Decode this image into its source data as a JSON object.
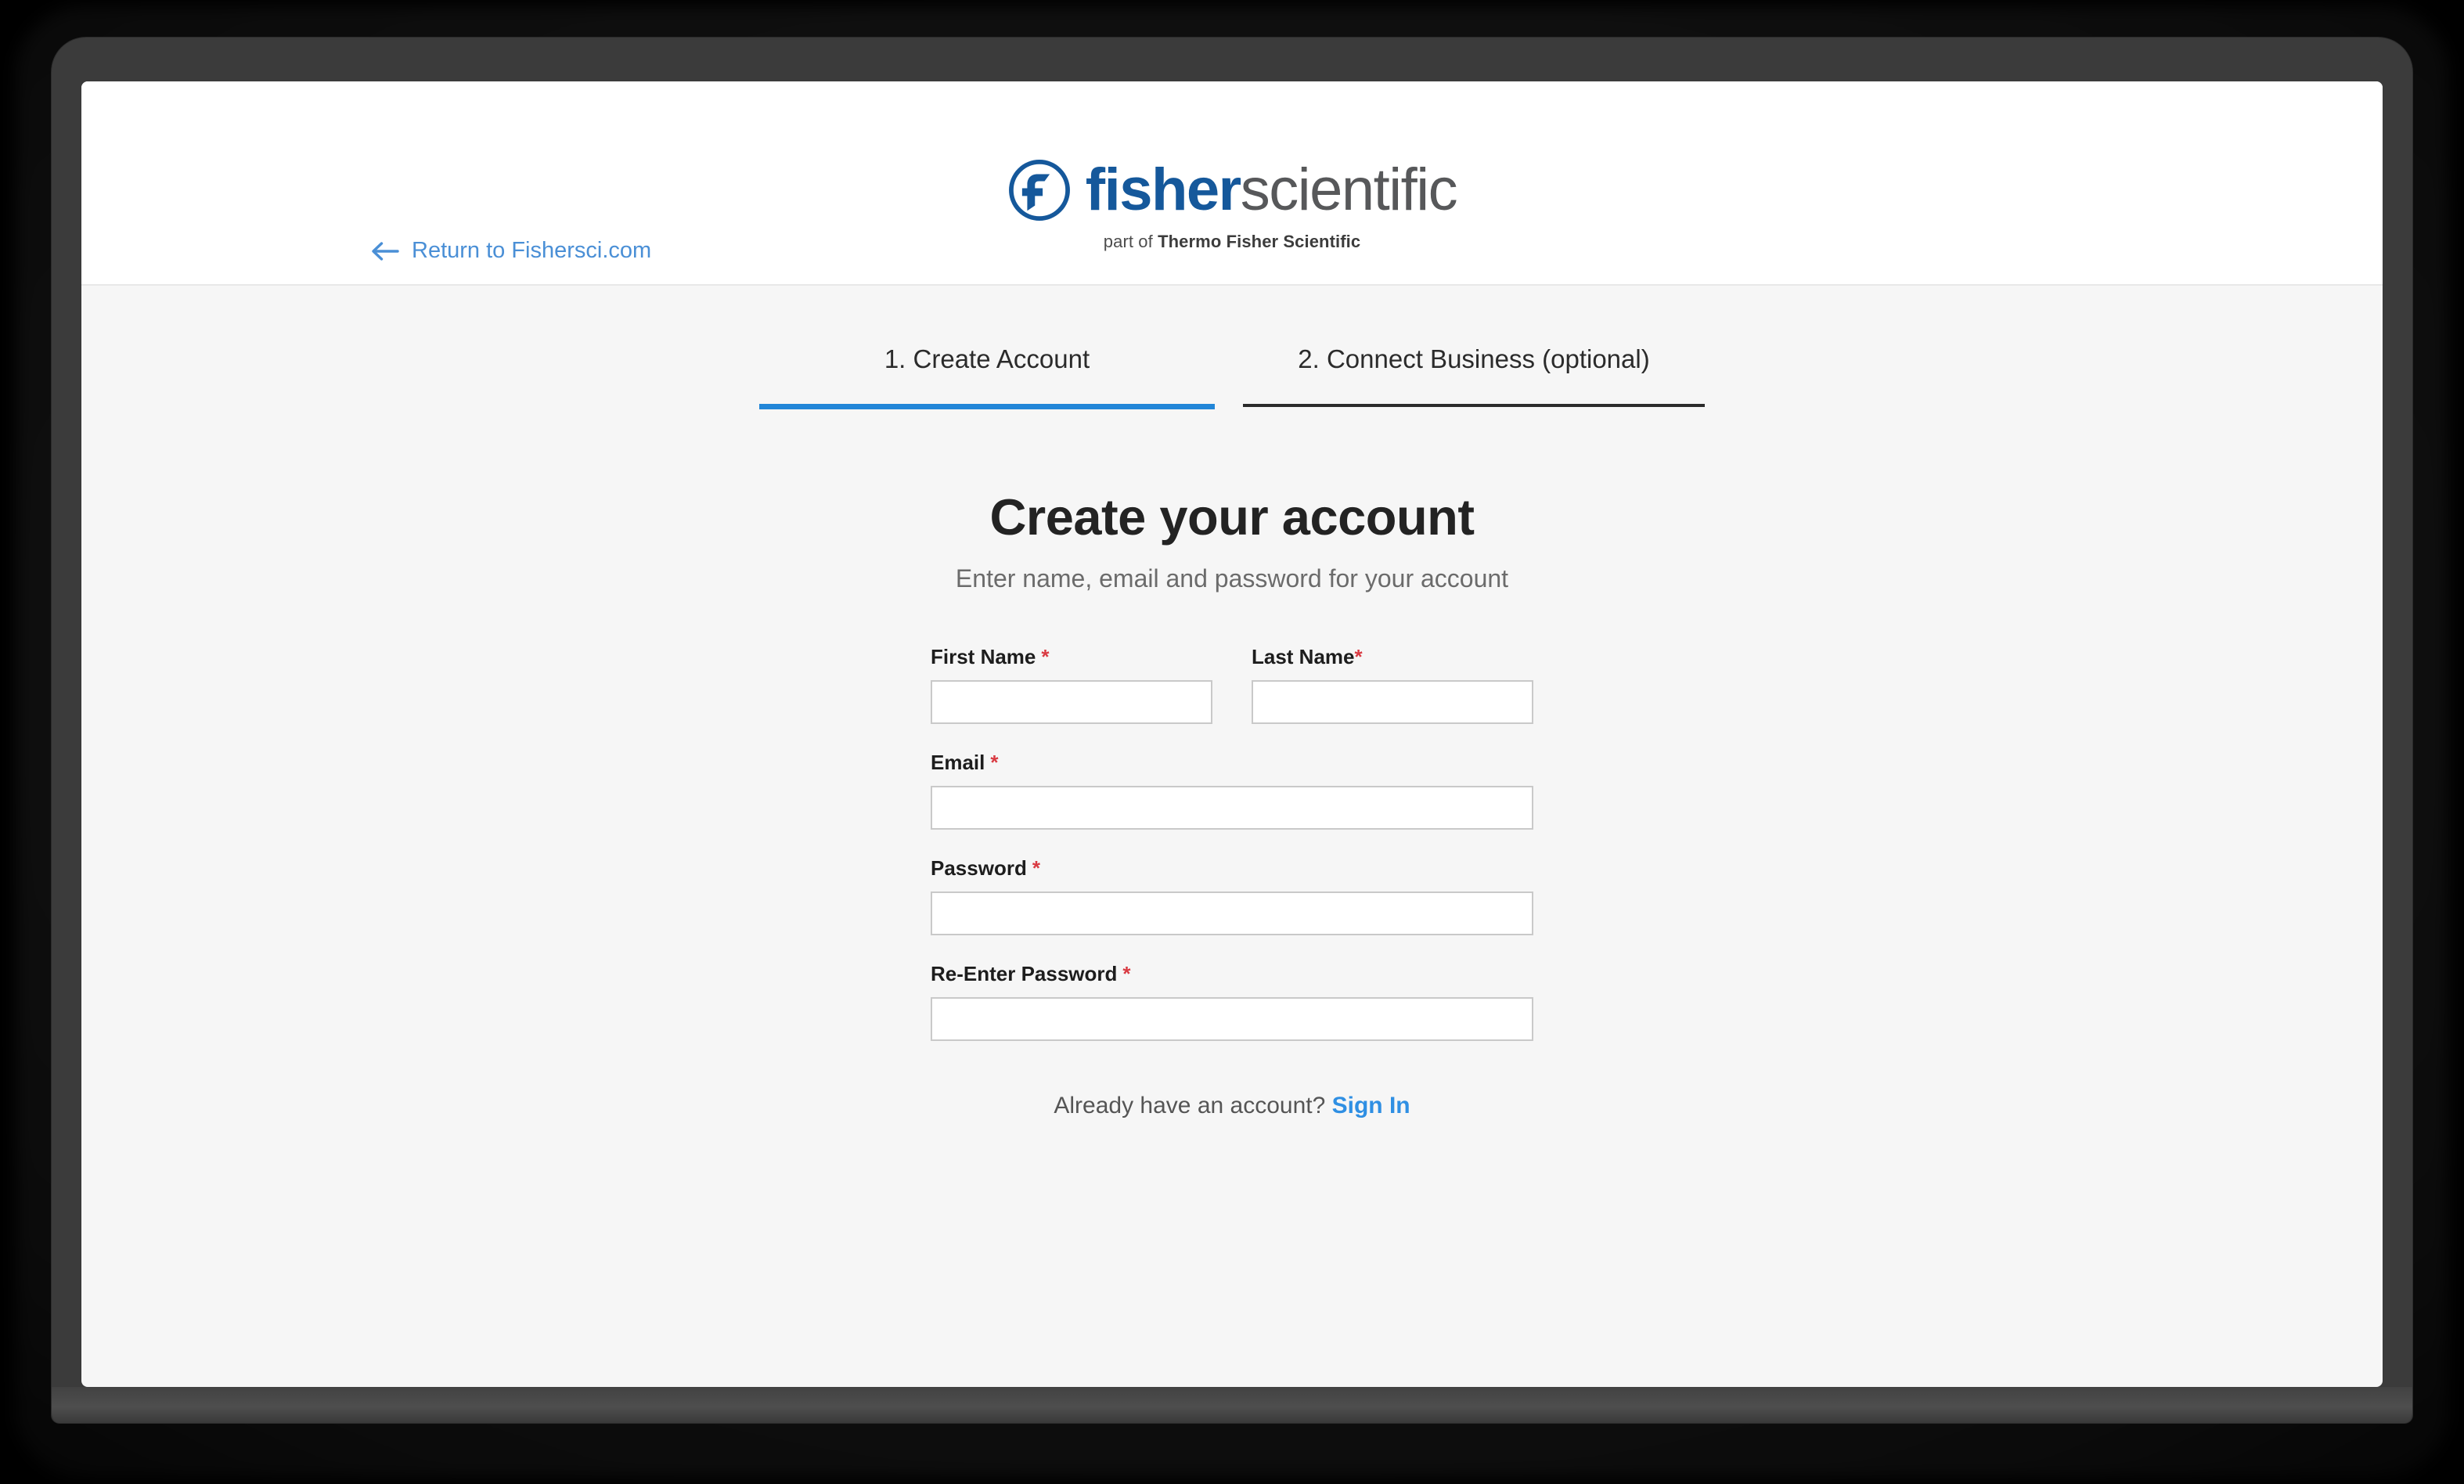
{
  "device": {
    "camera_icon": "camera-dot",
    "speaker_icon": "speaker-grille"
  },
  "header": {
    "return_link": {
      "label": "Return to Fishersci.com",
      "icon": "arrow-left-icon",
      "color": "#4a8fd6"
    },
    "logo": {
      "mark_icon": "fisher-f-circle-logo",
      "word_primary": "fisher",
      "word_secondary": "scientific",
      "tagline_prefix": "part of ",
      "tagline_brand": "Thermo Fisher Scientific",
      "primary_color": "#15589b",
      "secondary_color": "#57585a"
    }
  },
  "steps": {
    "active_index": 0,
    "items": [
      {
        "label": "1. Create Account",
        "active": true
      },
      {
        "label": "2. Connect Business (optional)",
        "active": false
      }
    ],
    "active_color": "#2286d8",
    "inactive_color": "#2b2b2b"
  },
  "form": {
    "title": "Create your account",
    "subtitle": "Enter name, email and password for your account",
    "required_marker": "*",
    "required_color": "#d93a42",
    "fields": [
      {
        "label": "First Name",
        "marker_spaced": true,
        "value": "",
        "placeholder": "",
        "type": "text",
        "name": "first-name"
      },
      {
        "label": "Last Name",
        "marker_spaced": false,
        "value": "",
        "placeholder": "",
        "type": "text",
        "name": "last-name"
      },
      {
        "label": "Email",
        "marker_spaced": true,
        "value": "",
        "placeholder": "",
        "type": "email",
        "name": "email"
      },
      {
        "label": "Password",
        "marker_spaced": true,
        "value": "",
        "placeholder": "",
        "type": "password",
        "name": "password"
      },
      {
        "label": "Re-Enter Password",
        "marker_spaced": true,
        "value": "",
        "placeholder": "",
        "type": "password",
        "name": "reenter-password"
      }
    ]
  },
  "footer": {
    "signin_prompt": "Already have an account?",
    "signin_label": "Sign In",
    "signin_color": "#2f8fe3"
  }
}
